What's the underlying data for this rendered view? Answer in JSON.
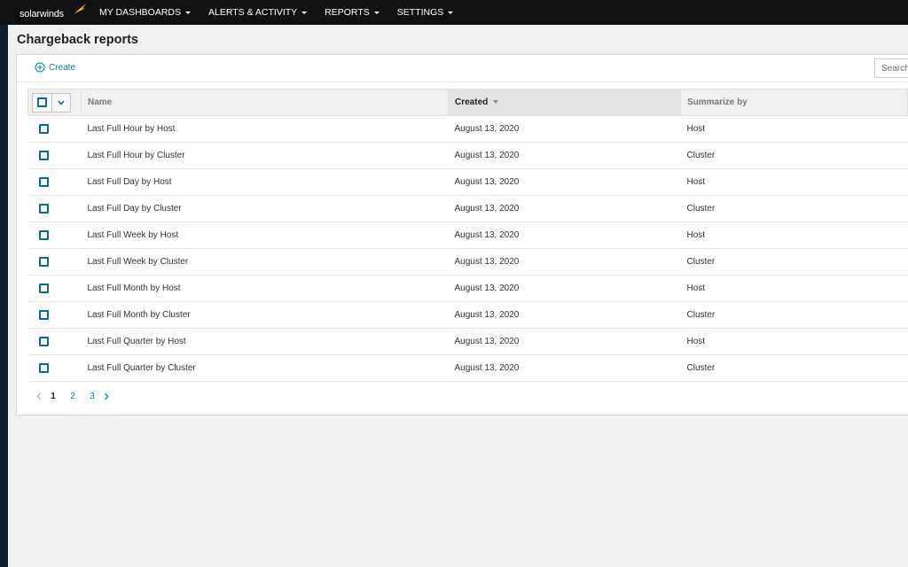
{
  "header": {
    "brand": "solarwinds",
    "menu": [
      {
        "label": "MY DASHBOARDS"
      },
      {
        "label": "ALERTS & ACTIVITY"
      },
      {
        "label": "REPORTS"
      },
      {
        "label": "SETTINGS"
      }
    ]
  },
  "page": {
    "title": "Chargeback reports"
  },
  "toolbar": {
    "create_label": "Create",
    "search_placeholder": "Search"
  },
  "table": {
    "columns": [
      "Name",
      "Created",
      "Summarize by"
    ],
    "rows": [
      {
        "name": "Last Full Hour by Host",
        "created": "August 13, 2020",
        "summarize": "Host"
      },
      {
        "name": "Last Full Hour by Cluster",
        "created": "August 13, 2020",
        "summarize": "Cluster"
      },
      {
        "name": "Last Full Day by Host",
        "created": "August 13, 2020",
        "summarize": "Host"
      },
      {
        "name": "Last Full Day by Cluster",
        "created": "August 13, 2020",
        "summarize": "Cluster"
      },
      {
        "name": "Last Full Week by Host",
        "created": "August 13, 2020",
        "summarize": "Host"
      },
      {
        "name": "Last Full Week by Cluster",
        "created": "August 13, 2020",
        "summarize": "Cluster"
      },
      {
        "name": "Last Full Month by Host",
        "created": "August 13, 2020",
        "summarize": "Host"
      },
      {
        "name": "Last Full Month by Cluster",
        "created": "August 13, 2020",
        "summarize": "Cluster"
      },
      {
        "name": "Last Full Quarter by Host",
        "created": "August 13, 2020",
        "summarize": "Host"
      },
      {
        "name": "Last Full Quarter by Cluster",
        "created": "August 13, 2020",
        "summarize": "Cluster"
      }
    ]
  },
  "pagination": {
    "pages": [
      "1",
      "2",
      "3"
    ],
    "current": "1"
  },
  "colors": {
    "topbar": "#111111",
    "accent": "#0079aa",
    "checkbox": "#0a6c88",
    "logo_orange": "#f99d1c"
  }
}
